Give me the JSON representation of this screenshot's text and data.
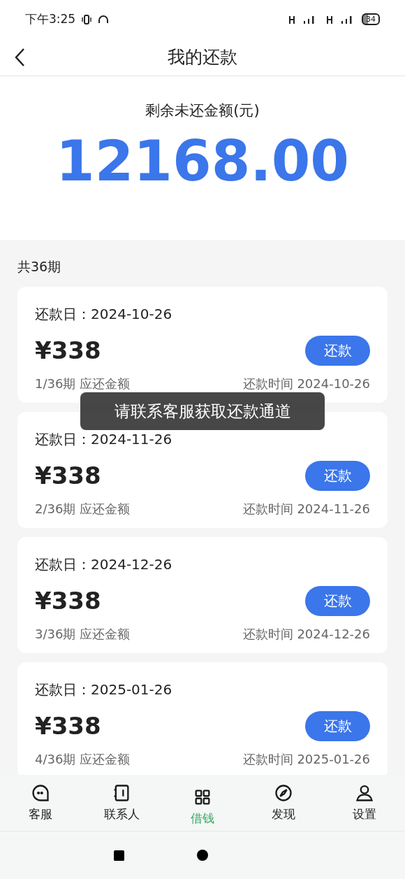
{
  "status_bar": {
    "time": "下午3:25",
    "battery": "34"
  },
  "header": {
    "title": "我的还款"
  },
  "summary": {
    "label": "剩余未还金额(元)",
    "amount": "12168.00"
  },
  "period_count": "共36期",
  "installments": [
    {
      "due_date": "还款日：2024-10-26",
      "amount": "¥338",
      "period": "1/36期 应还金额",
      "time": "还款时间 2024-10-26",
      "button": "还款"
    },
    {
      "due_date": "还款日：2024-11-26",
      "amount": "¥338",
      "period": "2/36期 应还金额",
      "time": "还款时间 2024-11-26",
      "button": "还款"
    },
    {
      "due_date": "还款日：2024-12-26",
      "amount": "¥338",
      "period": "3/36期 应还金额",
      "time": "还款时间 2024-12-26",
      "button": "还款"
    },
    {
      "due_date": "还款日：2025-01-26",
      "amount": "¥338",
      "period": "4/36期 应还金额",
      "time": "还款时间 2025-01-26",
      "button": "还款"
    }
  ],
  "toast": "请联系客服获取还款通道",
  "nav": [
    {
      "label": "客服",
      "kind": "chat",
      "selected": false
    },
    {
      "label": "联系人",
      "kind": "contacts",
      "selected": false
    },
    {
      "label": "借钱",
      "kind": "grid",
      "selected": true
    },
    {
      "label": "发现",
      "kind": "compass",
      "selected": false
    },
    {
      "label": "设置",
      "kind": "person",
      "selected": false
    }
  ]
}
